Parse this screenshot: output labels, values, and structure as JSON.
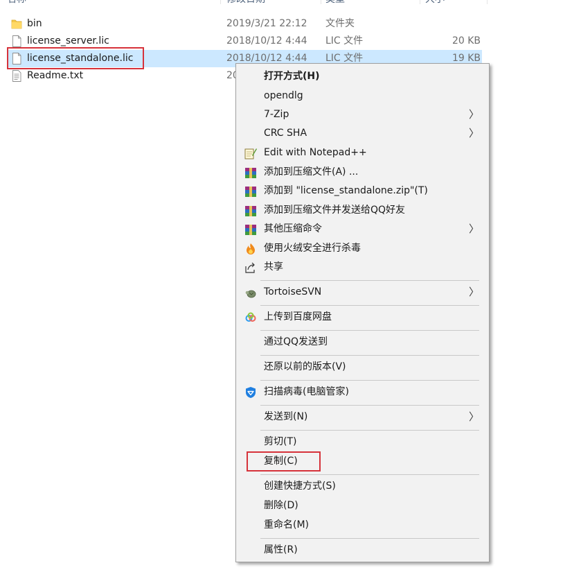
{
  "columns": [
    "名称",
    "修改日期",
    "类型",
    "大小"
  ],
  "files": [
    {
      "name": "bin",
      "date": "2019/3/21 22:12",
      "type": "文件夹",
      "size": "",
      "icon": "folder-icon"
    },
    {
      "name": "license_server.lic",
      "date": "2018/10/12 4:44",
      "type": "LIC 文件",
      "size": "20 KB",
      "icon": "file-icon"
    },
    {
      "name": "license_standalone.lic",
      "date": "2018/10/12 4:44",
      "type": "LIC 文件",
      "size": "19 KB",
      "icon": "file-icon",
      "selected": true
    },
    {
      "name": "Readme.txt",
      "date": "20",
      "type": "",
      "size": "",
      "icon": "text-file-icon"
    }
  ],
  "menu": {
    "items": [
      {
        "label": "打开方式(H)",
        "bold": true,
        "icon": ""
      },
      {
        "label": "opendlg",
        "icon": ""
      },
      {
        "label": "7-Zip",
        "icon": "",
        "submenu": true
      },
      {
        "label": "CRC SHA",
        "icon": "",
        "submenu": true
      },
      {
        "label": "Edit with Notepad++",
        "icon": "notepad-plus-plus-icon"
      },
      {
        "label": "添加到压缩文件(A) ...",
        "icon": "winrar-icon"
      },
      {
        "label": "添加到 \"license_standalone.zip\"(T)",
        "icon": "winrar-icon"
      },
      {
        "label": "添加到压缩文件并发送给QQ好友",
        "icon": "winrar-icon"
      },
      {
        "label": "其他压缩命令",
        "icon": "winrar-icon",
        "submenu": true
      },
      {
        "label": "使用火绒安全进行杀毒",
        "icon": "huorong-icon"
      },
      {
        "label": "共享",
        "icon": "share-icon"
      },
      {
        "label": "TortoiseSVN",
        "icon": "tortoisesvn-icon",
        "submenu": true
      },
      {
        "label": "上传到百度网盘",
        "icon": "baidu-netdisk-icon"
      },
      {
        "label": "通过QQ发送到",
        "icon": ""
      },
      {
        "label": "还原以前的版本(V)",
        "icon": ""
      },
      {
        "label": "扫描病毒(电脑管家)",
        "icon": "tencent-pc-manager-icon"
      },
      {
        "label": "发送到(N)",
        "icon": "",
        "submenu": true
      },
      {
        "label": "剪切(T)",
        "icon": ""
      },
      {
        "label": "复制(C)",
        "icon": "",
        "highlighted": true
      },
      {
        "label": "创建快捷方式(S)",
        "icon": ""
      },
      {
        "label": "删除(D)",
        "icon": ""
      },
      {
        "label": "重命名(M)",
        "icon": ""
      },
      {
        "label": "属性(R)",
        "icon": ""
      }
    ]
  },
  "submenu_arrow": "〉",
  "colors": {
    "selection": "#cce8ff",
    "highlight_box": "#d6323a",
    "menu_bg": "#f2f2f2"
  }
}
